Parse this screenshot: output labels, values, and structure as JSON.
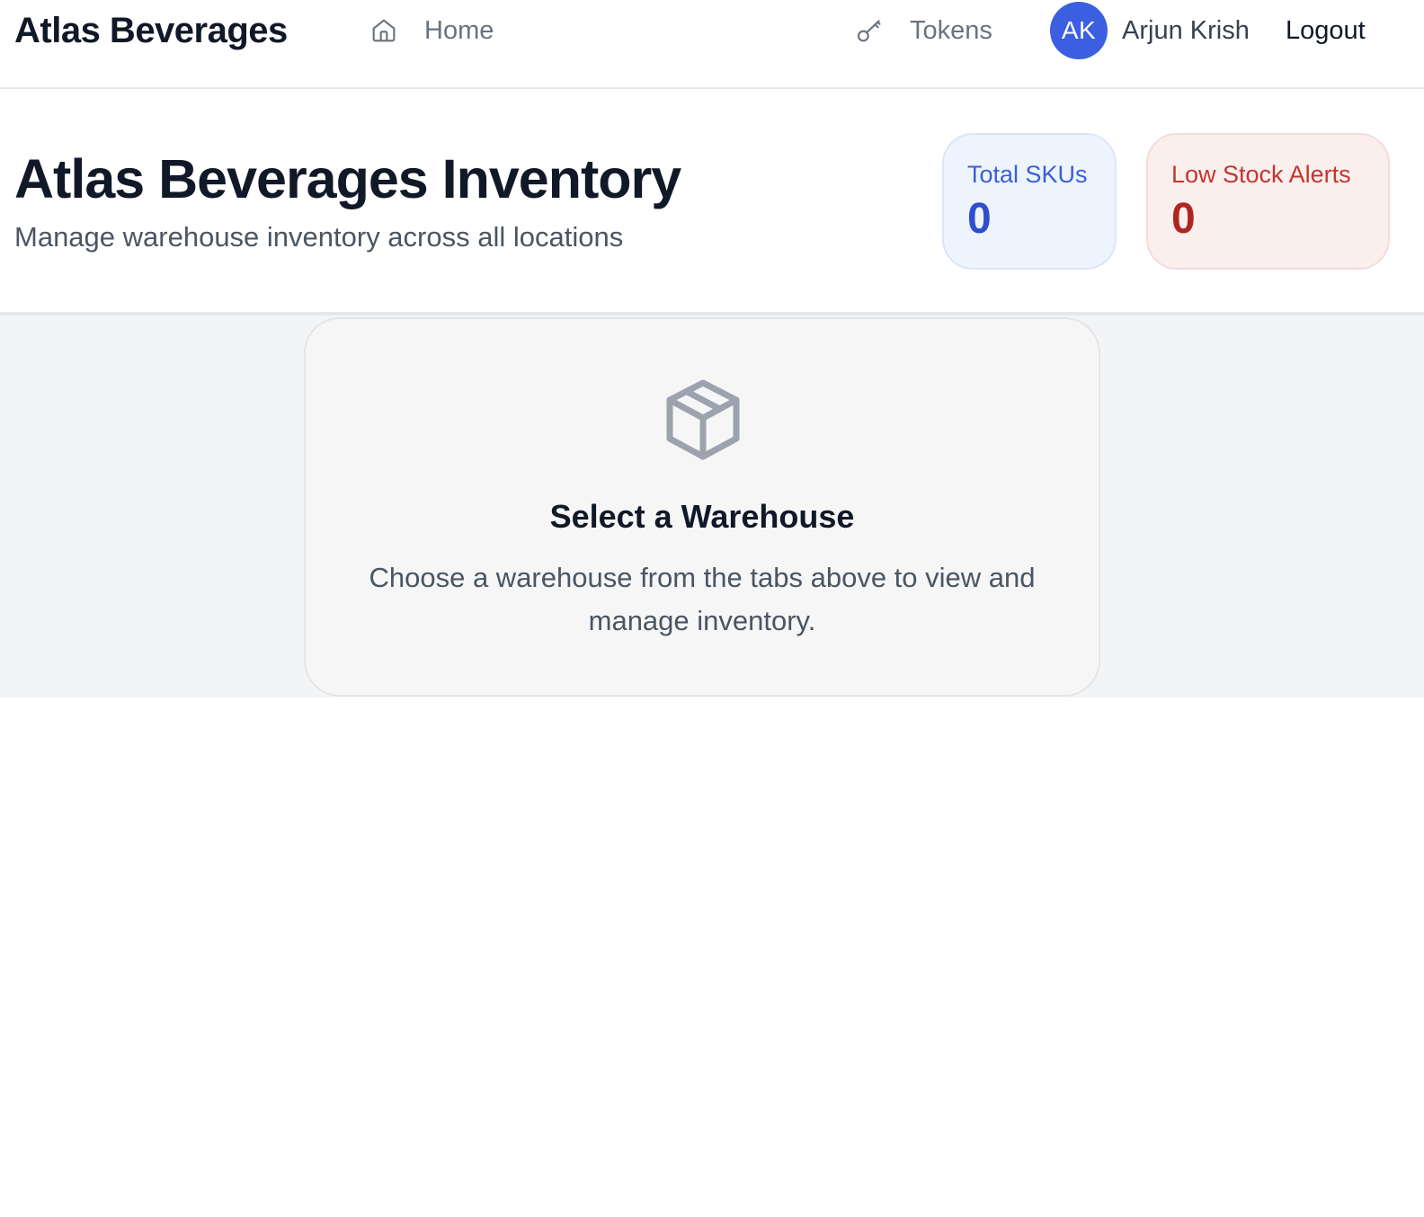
{
  "app": {
    "brand": "Atlas Beverages"
  },
  "nav": {
    "home_label": "Home",
    "home_icon": "home-icon",
    "tokens_label": "Tokens",
    "tokens_icon": "key-icon"
  },
  "user": {
    "initials": "AK",
    "name": "Arjun Krish",
    "avatar_color": "#3b5fe0",
    "logout_label": "Logout"
  },
  "header": {
    "title": "Atlas Beverages Inventory",
    "subtitle": "Manage warehouse inventory across all locations"
  },
  "stats": {
    "total_skus": {
      "label": "Total SKUs",
      "value": "0",
      "color": "#2e4fce"
    },
    "low_stock_alerts": {
      "label": "Low Stock Alerts",
      "value": "0",
      "color": "#b0261f"
    }
  },
  "empty_state": {
    "icon": "package-icon",
    "title": "Select a Warehouse",
    "message": "Choose a warehouse from the tabs above to view and manage inventory."
  }
}
